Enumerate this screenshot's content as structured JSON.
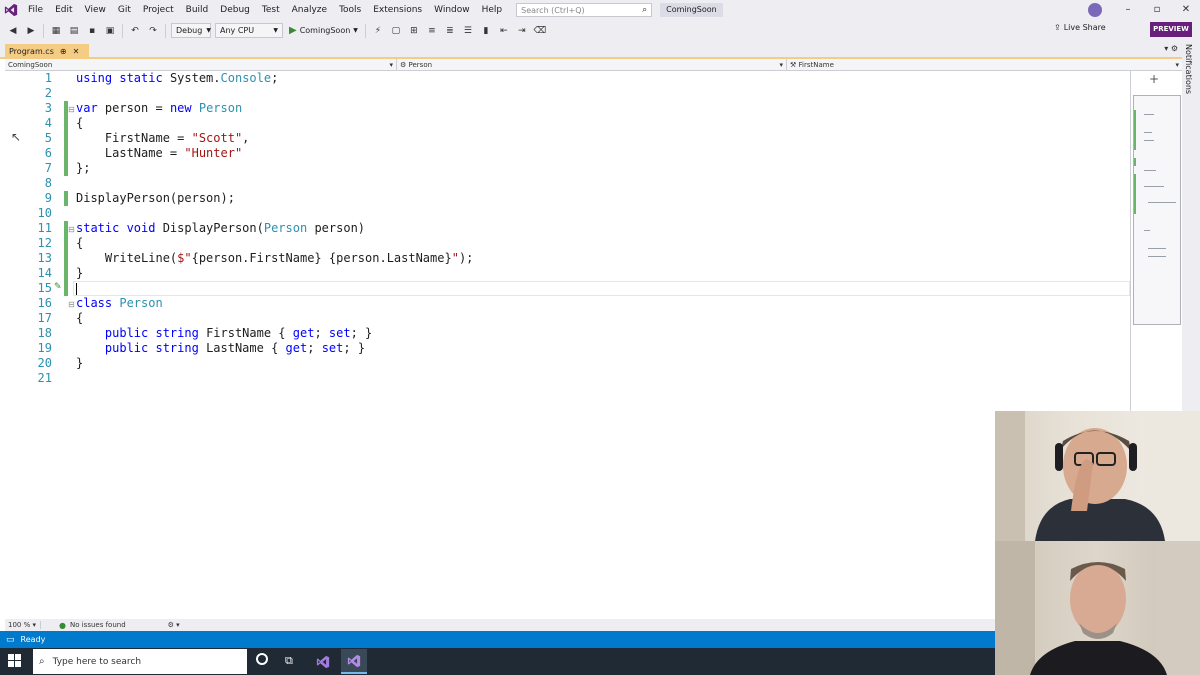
{
  "menubar": {
    "items": [
      "File",
      "Edit",
      "View",
      "Git",
      "Project",
      "Build",
      "Debug",
      "Test",
      "Analyze",
      "Tools",
      "Extensions",
      "Window",
      "Help"
    ],
    "search_placeholder": "Search (Ctrl+Q)",
    "solution_name": "ComingSoon",
    "window_controls": [
      "–",
      "▫",
      "✕"
    ]
  },
  "toolbar": {
    "config": "Debug",
    "platform": "Any CPU",
    "run_target": "ComingSoon",
    "live_share": "Live Share",
    "preview": "PREVIEW"
  },
  "tabs": {
    "active_file": "Program.cs",
    "pin_glyph": "⊕",
    "close_glyph": "✕"
  },
  "navbar": {
    "project": "ComingSoon",
    "type": "Person",
    "member": "FirstName"
  },
  "notifications_label": "Notifications",
  "editor": {
    "lines": [
      {
        "n": "1",
        "code": [
          {
            "t": "using ",
            "c": "kw"
          },
          {
            "t": "static ",
            "c": "kw"
          },
          {
            "t": "System.",
            "c": ""
          },
          {
            "t": "Console",
            "c": "ty"
          },
          {
            "t": ";",
            "c": ""
          }
        ]
      },
      {
        "n": "2",
        "code": []
      },
      {
        "n": "3",
        "code": [
          {
            "t": "var ",
            "c": "kw"
          },
          {
            "t": "person = ",
            "c": ""
          },
          {
            "t": "new ",
            "c": "kw"
          },
          {
            "t": "Person",
            "c": "ty"
          }
        ]
      },
      {
        "n": "4",
        "code": [
          {
            "t": "{",
            "c": ""
          }
        ]
      },
      {
        "n": "5",
        "code": [
          {
            "t": "    FirstName = ",
            "c": ""
          },
          {
            "t": "\"Scott\"",
            "c": "str"
          },
          {
            "t": ",",
            "c": ""
          }
        ]
      },
      {
        "n": "6",
        "code": [
          {
            "t": "    LastName = ",
            "c": ""
          },
          {
            "t": "\"Hunter\"",
            "c": "str"
          }
        ]
      },
      {
        "n": "7",
        "code": [
          {
            "t": "};",
            "c": ""
          }
        ]
      },
      {
        "n": "8",
        "code": []
      },
      {
        "n": "9",
        "code": [
          {
            "t": "DisplayPerson(person);",
            "c": ""
          }
        ]
      },
      {
        "n": "10",
        "code": []
      },
      {
        "n": "11",
        "code": [
          {
            "t": "static ",
            "c": "kw"
          },
          {
            "t": "void ",
            "c": "kw"
          },
          {
            "t": "DisplayPerson(",
            "c": ""
          },
          {
            "t": "Person",
            "c": "ty"
          },
          {
            "t": " person)",
            "c": ""
          }
        ]
      },
      {
        "n": "12",
        "code": [
          {
            "t": "{",
            "c": ""
          }
        ]
      },
      {
        "n": "13",
        "code": [
          {
            "t": "    WriteLine(",
            "c": ""
          },
          {
            "t": "$\"",
            "c": "str"
          },
          {
            "t": "{person.FirstName}",
            "c": ""
          },
          {
            "t": " ",
            "c": "str"
          },
          {
            "t": "{person.LastName}",
            "c": ""
          },
          {
            "t": "\"",
            "c": "str"
          },
          {
            "t": ");",
            "c": ""
          }
        ]
      },
      {
        "n": "14",
        "code": [
          {
            "t": "}",
            "c": ""
          }
        ]
      },
      {
        "n": "15",
        "code": []
      },
      {
        "n": "16",
        "code": [
          {
            "t": "class ",
            "c": "kw"
          },
          {
            "t": "Person",
            "c": "ty"
          }
        ]
      },
      {
        "n": "17",
        "code": [
          {
            "t": "{",
            "c": ""
          }
        ]
      },
      {
        "n": "18",
        "code": [
          {
            "t": "    ",
            "c": ""
          },
          {
            "t": "public ",
            "c": "kw"
          },
          {
            "t": "string ",
            "c": "kw"
          },
          {
            "t": "FirstName { ",
            "c": ""
          },
          {
            "t": "get",
            "c": "kw"
          },
          {
            "t": "; ",
            "c": ""
          },
          {
            "t": "set",
            "c": "kw"
          },
          {
            "t": "; }",
            "c": ""
          }
        ]
      },
      {
        "n": "19",
        "code": [
          {
            "t": "    ",
            "c": ""
          },
          {
            "t": "public ",
            "c": "kw"
          },
          {
            "t": "string ",
            "c": "kw"
          },
          {
            "t": "LastName { ",
            "c": ""
          },
          {
            "t": "get",
            "c": "kw"
          },
          {
            "t": "; ",
            "c": ""
          },
          {
            "t": "set",
            "c": "kw"
          },
          {
            "t": "; }",
            "c": ""
          }
        ]
      },
      {
        "n": "20",
        "code": [
          {
            "t": "}",
            "c": ""
          }
        ]
      },
      {
        "n": "21",
        "code": []
      }
    ]
  },
  "editor_status": {
    "zoom": "100 %",
    "issues": "No issues found"
  },
  "statusbar": {
    "text": "Ready"
  },
  "taskbar": {
    "search_placeholder": "Type here to search"
  },
  "colors": {
    "accent": "#007acc",
    "brand": "#68217a",
    "tab_active": "#f5cc84",
    "keyword": "#0000ff",
    "type": "#2b91af",
    "string": "#a31515",
    "change_bar": "#6bb56b"
  }
}
